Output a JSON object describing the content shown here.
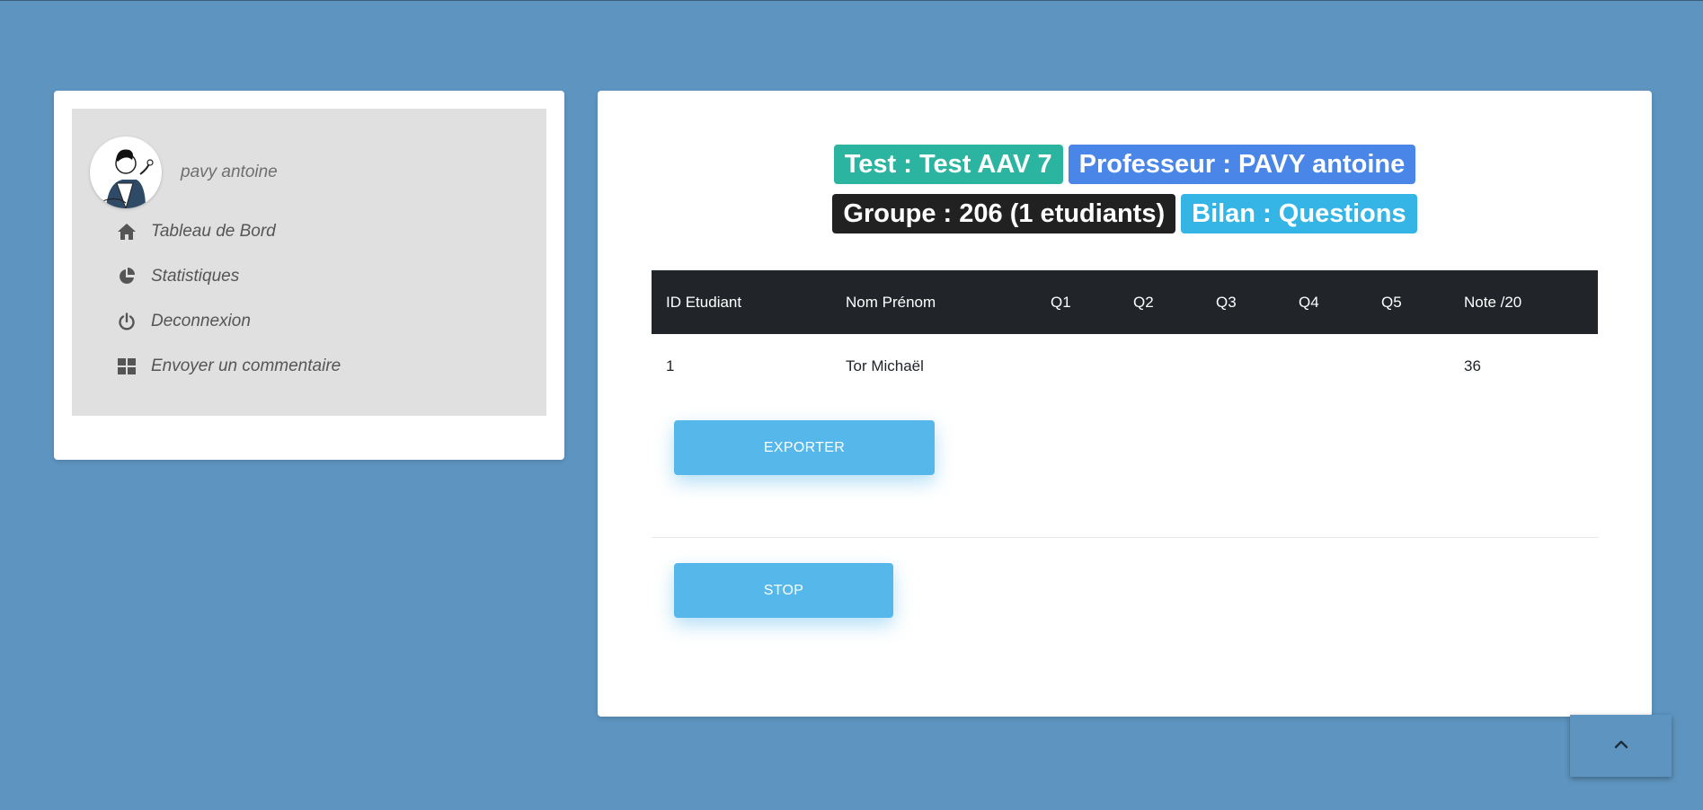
{
  "user": {
    "name": "pavy antoine"
  },
  "nav": {
    "items": [
      {
        "label": "Tableau de Bord",
        "icon": "home-icon"
      },
      {
        "label": "Statistiques",
        "icon": "pie-chart-icon"
      },
      {
        "label": "Deconnexion",
        "icon": "power-icon"
      },
      {
        "label": "Envoyer un commentaire",
        "icon": "grid-icon"
      }
    ]
  },
  "header": {
    "test": "Test : Test AAV 7",
    "professeur": "Professeur : PAVY antoine",
    "groupe": "Groupe : 206 (1 etudiants)",
    "bilan": "Bilan : Questions"
  },
  "colors": {
    "page_bg": "#5e95c0",
    "badge_test": "#2bb4a0",
    "badge_prof": "#4a86e8",
    "badge_group": "#212121",
    "badge_bilan": "#35b5e5",
    "button": "#56b8ea",
    "table_header": "#212529"
  },
  "table": {
    "headers": [
      "ID Etudiant",
      "Nom Prénom",
      "Q1",
      "Q2",
      "Q3",
      "Q4",
      "Q5",
      "Note /20"
    ],
    "rows": [
      [
        "1",
        "Tor Michaël",
        "",
        "",
        "",
        "",
        "",
        "36"
      ]
    ]
  },
  "actions": {
    "export_label": "EXPORTER",
    "stop_label": "STOP"
  }
}
